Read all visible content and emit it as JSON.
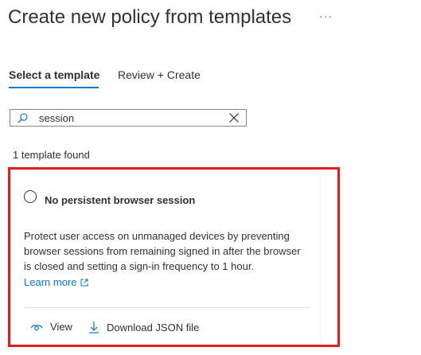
{
  "header": {
    "title": "Create new policy from templates",
    "more": "···"
  },
  "tabs": [
    {
      "label": "Select a template"
    },
    {
      "label": "Review + Create"
    }
  ],
  "search": {
    "value": "session",
    "icon": "search-icon"
  },
  "results": {
    "count_text": "1 template found"
  },
  "template": {
    "title": "No persistent browser session",
    "description": "Protect user access on unmanaged devices by preventing browser sessions from remaining signed in after the browser is closed and setting a sign-in frequency to 1 hour.",
    "learn_more": "Learn more",
    "actions": {
      "view": "View",
      "download": "Download JSON file"
    }
  },
  "colors": {
    "accent": "#0078d4",
    "highlight": "#e0201f"
  }
}
